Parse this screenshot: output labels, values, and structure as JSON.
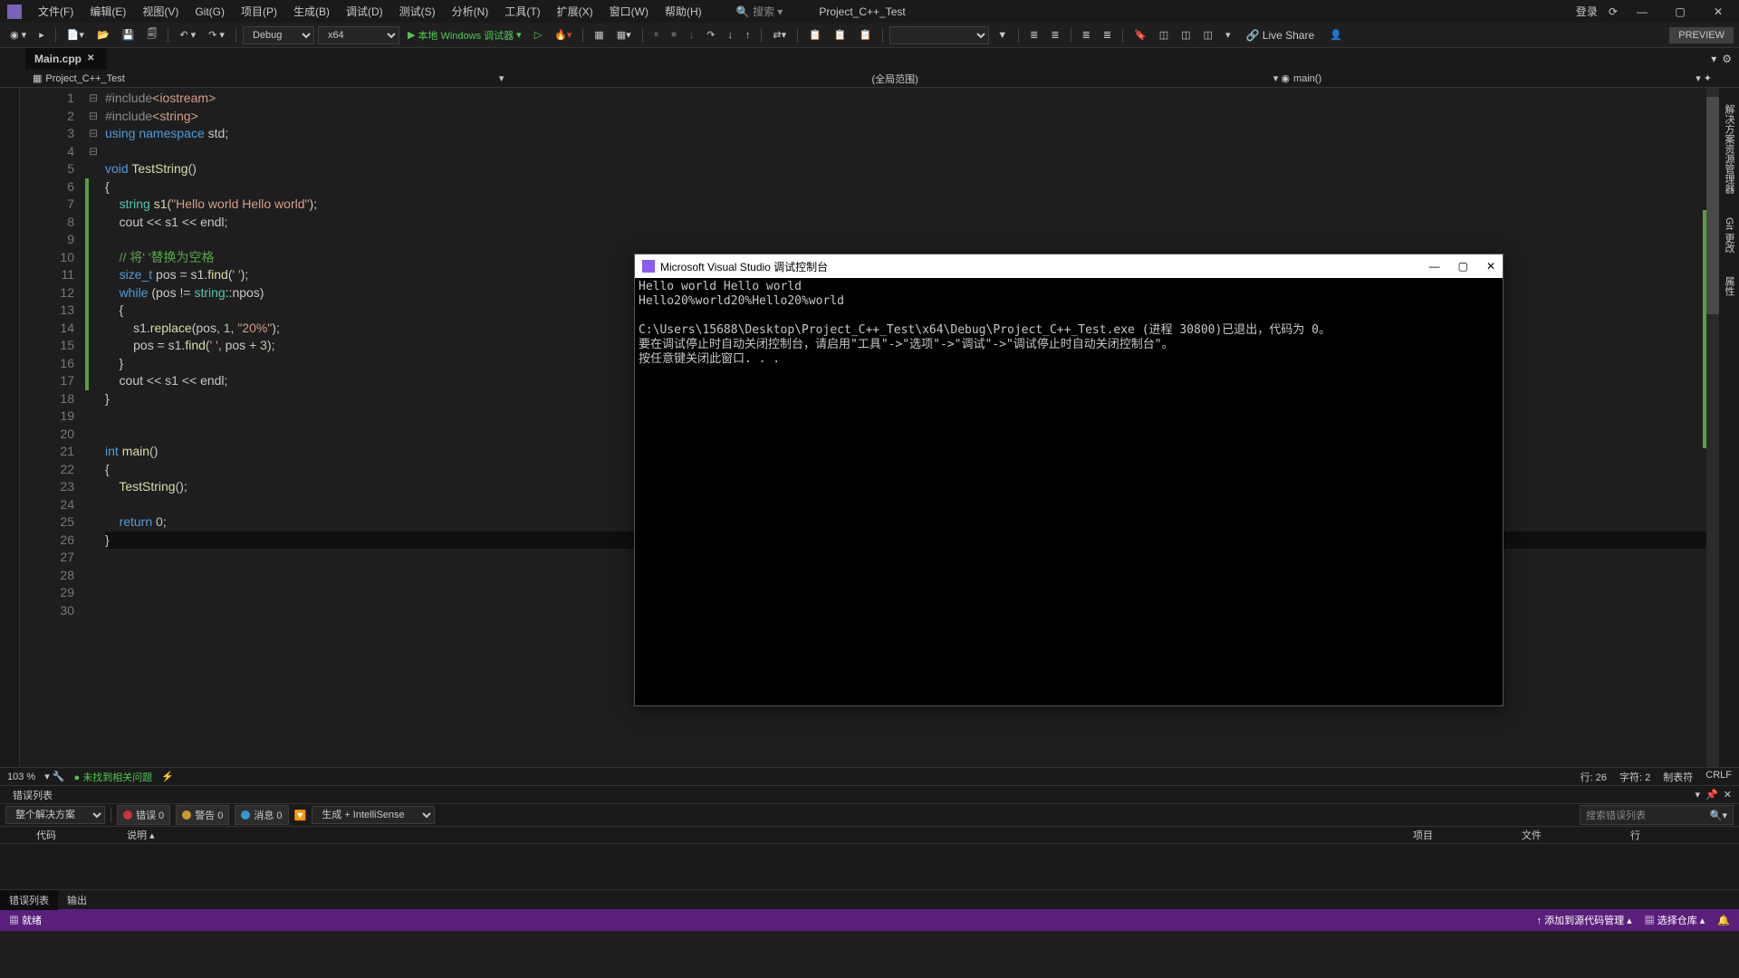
{
  "titlebar": {
    "menus": [
      "文件(F)",
      "编辑(E)",
      "视图(V)",
      "Git(G)",
      "项目(P)",
      "生成(B)",
      "调试(D)",
      "测试(S)",
      "分析(N)",
      "工具(T)",
      "扩展(X)",
      "窗口(W)",
      "帮助(H)"
    ],
    "search_placeholder": "搜索 ▾",
    "project": "Project_C++_Test",
    "login": "登录",
    "preview": "PREVIEW",
    "live_share": "Live Share"
  },
  "toolbar": {
    "config": "Debug",
    "platform": "x64",
    "debug_target": "本地 Windows 调试器"
  },
  "tabs": {
    "active": "Main.cpp"
  },
  "context": {
    "project": "Project_C++_Test",
    "scope": "(全局范围)",
    "func": "main()"
  },
  "code_lines": [
    {
      "n": 1,
      "f": "⊟",
      "html": "<span class='pp'>#include</span><span class='str'>&lt;iostream&gt;</span>"
    },
    {
      "n": 2,
      "f": "",
      "html": "<span class='pp'>#include</span><span class='str'>&lt;string&gt;</span>"
    },
    {
      "n": 3,
      "f": "",
      "html": "<span class='kw'>using</span> <span class='kw'>namespace</span> std;"
    },
    {
      "n": 4,
      "f": "",
      "html": ""
    },
    {
      "n": 5,
      "f": "⊟",
      "html": "<span class='kw'>void</span> <span class='fn'>TestString</span>()"
    },
    {
      "n": 6,
      "f": "",
      "html": "{",
      "c": true
    },
    {
      "n": 7,
      "f": "",
      "html": "    <span class='typ'>string</span> <span class='fn'>s1</span>(<span class='str'>\"Hello world Hello world\"</span>);",
      "c": true
    },
    {
      "n": 8,
      "f": "",
      "html": "    cout &lt;&lt; s1 &lt;&lt; endl;",
      "c": true
    },
    {
      "n": 9,
      "f": "",
      "html": "",
      "c": true
    },
    {
      "n": 10,
      "f": "",
      "html": "    <span class='cmt'>// 将' '替换为空格</span>",
      "c": true
    },
    {
      "n": 11,
      "f": "",
      "html": "    <span class='kw'>size_t</span> pos = s1.<span class='fn'>find</span>(<span class='str'>' '</span>);",
      "c": true
    },
    {
      "n": 12,
      "f": "⊟",
      "html": "    <span class='kw'>while</span> (pos != <span class='typ'>string</span>::npos)",
      "c": true
    },
    {
      "n": 13,
      "f": "",
      "html": "    {",
      "c": true
    },
    {
      "n": 14,
      "f": "",
      "html": "        s1.<span class='fn'>replace</span>(pos, <span class='num'>1</span>, <span class='str'>\"20%\"</span>);",
      "c": true
    },
    {
      "n": 15,
      "f": "",
      "html": "        pos = s1.<span class='fn'>find</span>(<span class='str'>' '</span>, pos + <span class='num'>3</span>);",
      "c": true
    },
    {
      "n": 16,
      "f": "",
      "html": "    }",
      "c": true
    },
    {
      "n": 17,
      "f": "",
      "html": "    cout &lt;&lt; s1 &lt;&lt; endl;",
      "c": true
    },
    {
      "n": 18,
      "f": "",
      "html": "}"
    },
    {
      "n": 19,
      "f": "",
      "html": ""
    },
    {
      "n": 20,
      "f": "",
      "html": ""
    },
    {
      "n": 21,
      "f": "⊟",
      "html": "<span class='kw'>int</span> <span class='fn'>main</span>()"
    },
    {
      "n": 22,
      "f": "",
      "html": "{"
    },
    {
      "n": 23,
      "f": "",
      "html": "    <span class='fn'>TestString</span>();"
    },
    {
      "n": 24,
      "f": "",
      "html": ""
    },
    {
      "n": 25,
      "f": "",
      "html": "    <span class='kw'>return</span> <span class='num'>0</span>;"
    },
    {
      "n": 26,
      "f": "",
      "html": "}",
      "cur": true
    },
    {
      "n": 27,
      "f": "",
      "html": ""
    },
    {
      "n": 28,
      "f": "",
      "html": ""
    },
    {
      "n": 29,
      "f": "",
      "html": ""
    },
    {
      "n": 30,
      "f": "",
      "html": ""
    }
  ],
  "console": {
    "title": "Microsoft Visual Studio 调试控制台",
    "lines": [
      "Hello world Hello world",
      "Hello20%world20%Hello20%world",
      "",
      "C:\\Users\\15688\\Desktop\\Project_C++_Test\\x64\\Debug\\Project_C++_Test.exe (进程 30800)已退出，代码为 0。",
      "要在调试停止时自动关闭控制台，请启用\"工具\"->\"选项\"->\"调试\"->\"调试停止时自动关闭控制台\"。",
      "按任意键关闭此窗口. . ."
    ]
  },
  "editor_status": {
    "zoom": "103 %",
    "issues": "未找到相关问题",
    "line": "行: 26",
    "char": "字符: 2",
    "tabs": "制表符",
    "eol": "CRLF"
  },
  "error_panel": {
    "title": "错误列表",
    "scope": "整个解决方案",
    "errors": "错误 0",
    "warnings": "警告 0",
    "messages": "消息 0",
    "build": "生成 + IntelliSense",
    "search_placeholder": "搜索错误列表",
    "cols": {
      "code": "代码",
      "desc": "说明",
      "project": "项目",
      "file": "文件",
      "line": "行"
    }
  },
  "bottom_tabs": {
    "errors": "错误列表",
    "output": "输出"
  },
  "statusbar": {
    "ready": "就绪",
    "add_source": "添加到源代码管理",
    "select_repo": "选择仓库"
  },
  "right_tabs": [
    "解决方案资源管理器",
    "Git 更改",
    "属性"
  ]
}
